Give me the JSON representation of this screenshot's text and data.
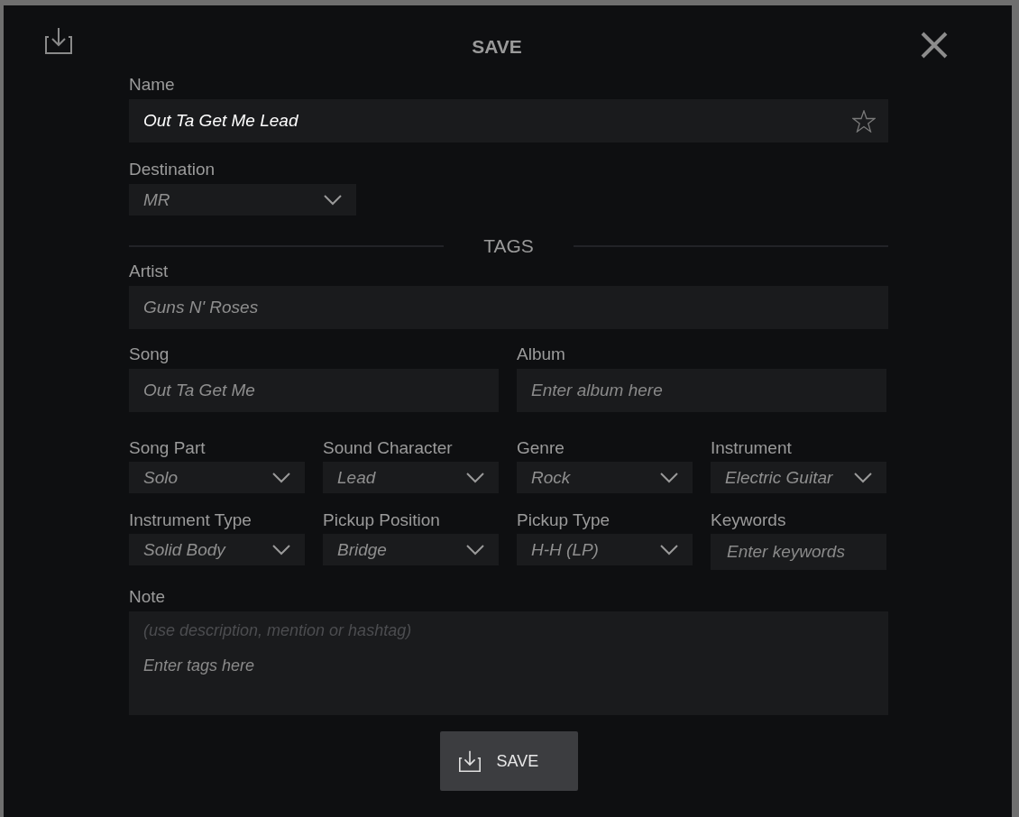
{
  "dialog": {
    "title": "SAVE"
  },
  "name": {
    "label": "Name",
    "value": "Out Ta Get Me Lead",
    "starred": false
  },
  "destination": {
    "label": "Destination",
    "value": "MR"
  },
  "tags_heading": "TAGS",
  "artist": {
    "label": "Artist",
    "value": "Guns N' Roses"
  },
  "song": {
    "label": "Song",
    "value": "Out Ta Get Me"
  },
  "album": {
    "label": "Album",
    "placeholder": "Enter album here"
  },
  "tag_fields": [
    {
      "kind": "select",
      "label": "Song Part",
      "value": "Solo"
    },
    {
      "kind": "select",
      "label": "Sound Character",
      "value": "Lead"
    },
    {
      "kind": "select",
      "label": "Genre",
      "value": "Rock"
    },
    {
      "kind": "select",
      "label": "Instrument",
      "value": "Electric Guitar"
    },
    {
      "kind": "select",
      "label": "Instrument Type",
      "value": "Solid Body"
    },
    {
      "kind": "select",
      "label": "Pickup Position",
      "value": "Bridge"
    },
    {
      "kind": "select",
      "label": "Pickup Type",
      "value": "H-H (LP)"
    },
    {
      "kind": "text",
      "label": "Keywords",
      "placeholder": "Enter keywords"
    }
  ],
  "note": {
    "label": "Note",
    "hint": "(use description, mention or hashtag)",
    "placeholder": "Enter tags here"
  },
  "save_button": {
    "label": "SAVE"
  }
}
